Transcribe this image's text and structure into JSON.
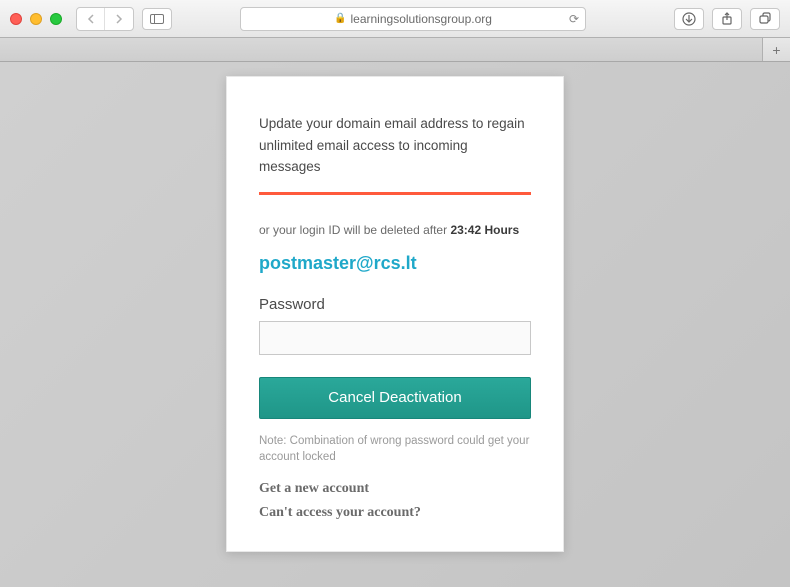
{
  "browser": {
    "url": "learningsolutionsgroup.org"
  },
  "card": {
    "heading": "Update your domain email address to regain unlimited email access to incoming messages",
    "warning_prefix": "or your login ID will be deleted after ",
    "warning_hours": "23:42 Hours",
    "email": "postmaster@rcs.lt",
    "password_label": "Password",
    "submit_label": "Cancel Deactivation",
    "note": "Note: Combination of wrong password could get your account locked",
    "link_new_account": "Get a new account",
    "link_cant_access": "Can't access your account?"
  }
}
